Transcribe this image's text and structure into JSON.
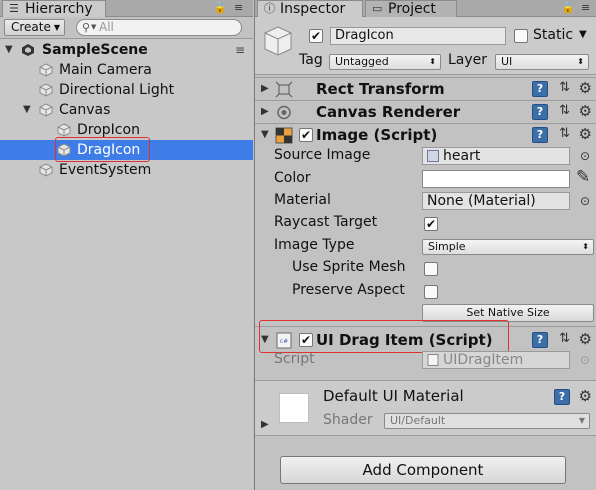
{
  "hierarchy": {
    "tab_label": "Hierarchy",
    "create_label": "Create",
    "search_placeholder": "All",
    "scene": "SampleScene",
    "items": [
      {
        "label": "Main Camera"
      },
      {
        "label": "Directional Light"
      },
      {
        "label": "Canvas"
      },
      {
        "label": "DropIcon"
      },
      {
        "label": "DragIcon"
      },
      {
        "label": "EventSystem"
      }
    ],
    "selected_item": "DragIcon"
  },
  "inspector": {
    "tabs": [
      {
        "label": "Inspector"
      },
      {
        "label": "Project"
      }
    ],
    "object": {
      "name": "DragIcon",
      "active": true,
      "static_label": "Static",
      "static": false,
      "tag_label": "Tag",
      "tag_value": "Untagged",
      "layer_label": "Layer",
      "layer_value": "UI"
    },
    "components": [
      {
        "title": "Rect Transform",
        "expanded": false
      },
      {
        "title": "Canvas Renderer",
        "expanded": false
      },
      {
        "title": "Image (Script)",
        "expanded": true,
        "enabled": true,
        "props": {
          "source_image_label": "Source Image",
          "source_image_value": "heart",
          "color_label": "Color",
          "color_value": "#ffffff",
          "material_label": "Material",
          "material_value": "None (Material)",
          "raycast_label": "Raycast Target",
          "raycast_value": true,
          "image_type_label": "Image Type",
          "image_type_value": "Simple",
          "use_sprite_mesh_label": "Use Sprite Mesh",
          "use_sprite_mesh_value": false,
          "preserve_aspect_label": "Preserve Aspect",
          "preserve_aspect_value": false,
          "set_native_size_label": "Set Native Size"
        }
      },
      {
        "title": "UI Drag Item (Script)",
        "expanded": true,
        "enabled": true,
        "props": {
          "script_label": "Script",
          "script_value": "UIDragItem"
        }
      }
    ],
    "material": {
      "name": "Default UI Material",
      "shader_label": "Shader",
      "shader_value": "UI/Default"
    },
    "add_component_label": "Add Component"
  }
}
